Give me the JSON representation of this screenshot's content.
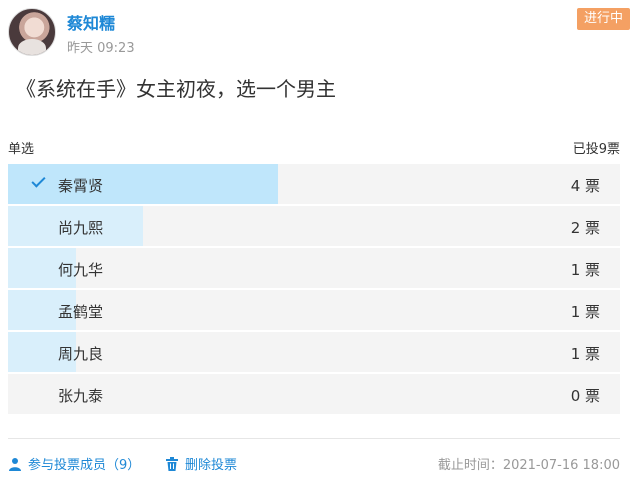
{
  "post": {
    "author": "蔡知糯",
    "time": "昨天 09:23",
    "status": "进行中",
    "question": "《系统在手》女主初夜，选一个男主"
  },
  "poll": {
    "type_label": "单选",
    "total_label": "已投9票",
    "total_votes": 9,
    "options": [
      {
        "label": "秦霄贤",
        "votes_label": "4 票",
        "votes": 4,
        "selected": true
      },
      {
        "label": "尚九熙",
        "votes_label": "2 票",
        "votes": 2,
        "selected": false
      },
      {
        "label": "何九华",
        "votes_label": "1 票",
        "votes": 1,
        "selected": false
      },
      {
        "label": "孟鹤堂",
        "votes_label": "1 票",
        "votes": 1,
        "selected": false
      },
      {
        "label": "周九良",
        "votes_label": "1 票",
        "votes": 1,
        "selected": false
      },
      {
        "label": "张九泰",
        "votes_label": "0 票",
        "votes": 0,
        "selected": false
      }
    ]
  },
  "footer": {
    "participants_label": "参与投票成员",
    "participants_count": "（9）",
    "delete_label": "删除投票",
    "deadline": "截止时间：2021-07-16 18:00"
  },
  "icons": {
    "participants": "user-icon",
    "delete": "trash-icon",
    "selected": "check-icon"
  },
  "colors": {
    "accent": "#1e88d6",
    "status": "#f4a063",
    "bar_selected": "#bfe6fb",
    "bar_default": "#d9effb"
  }
}
